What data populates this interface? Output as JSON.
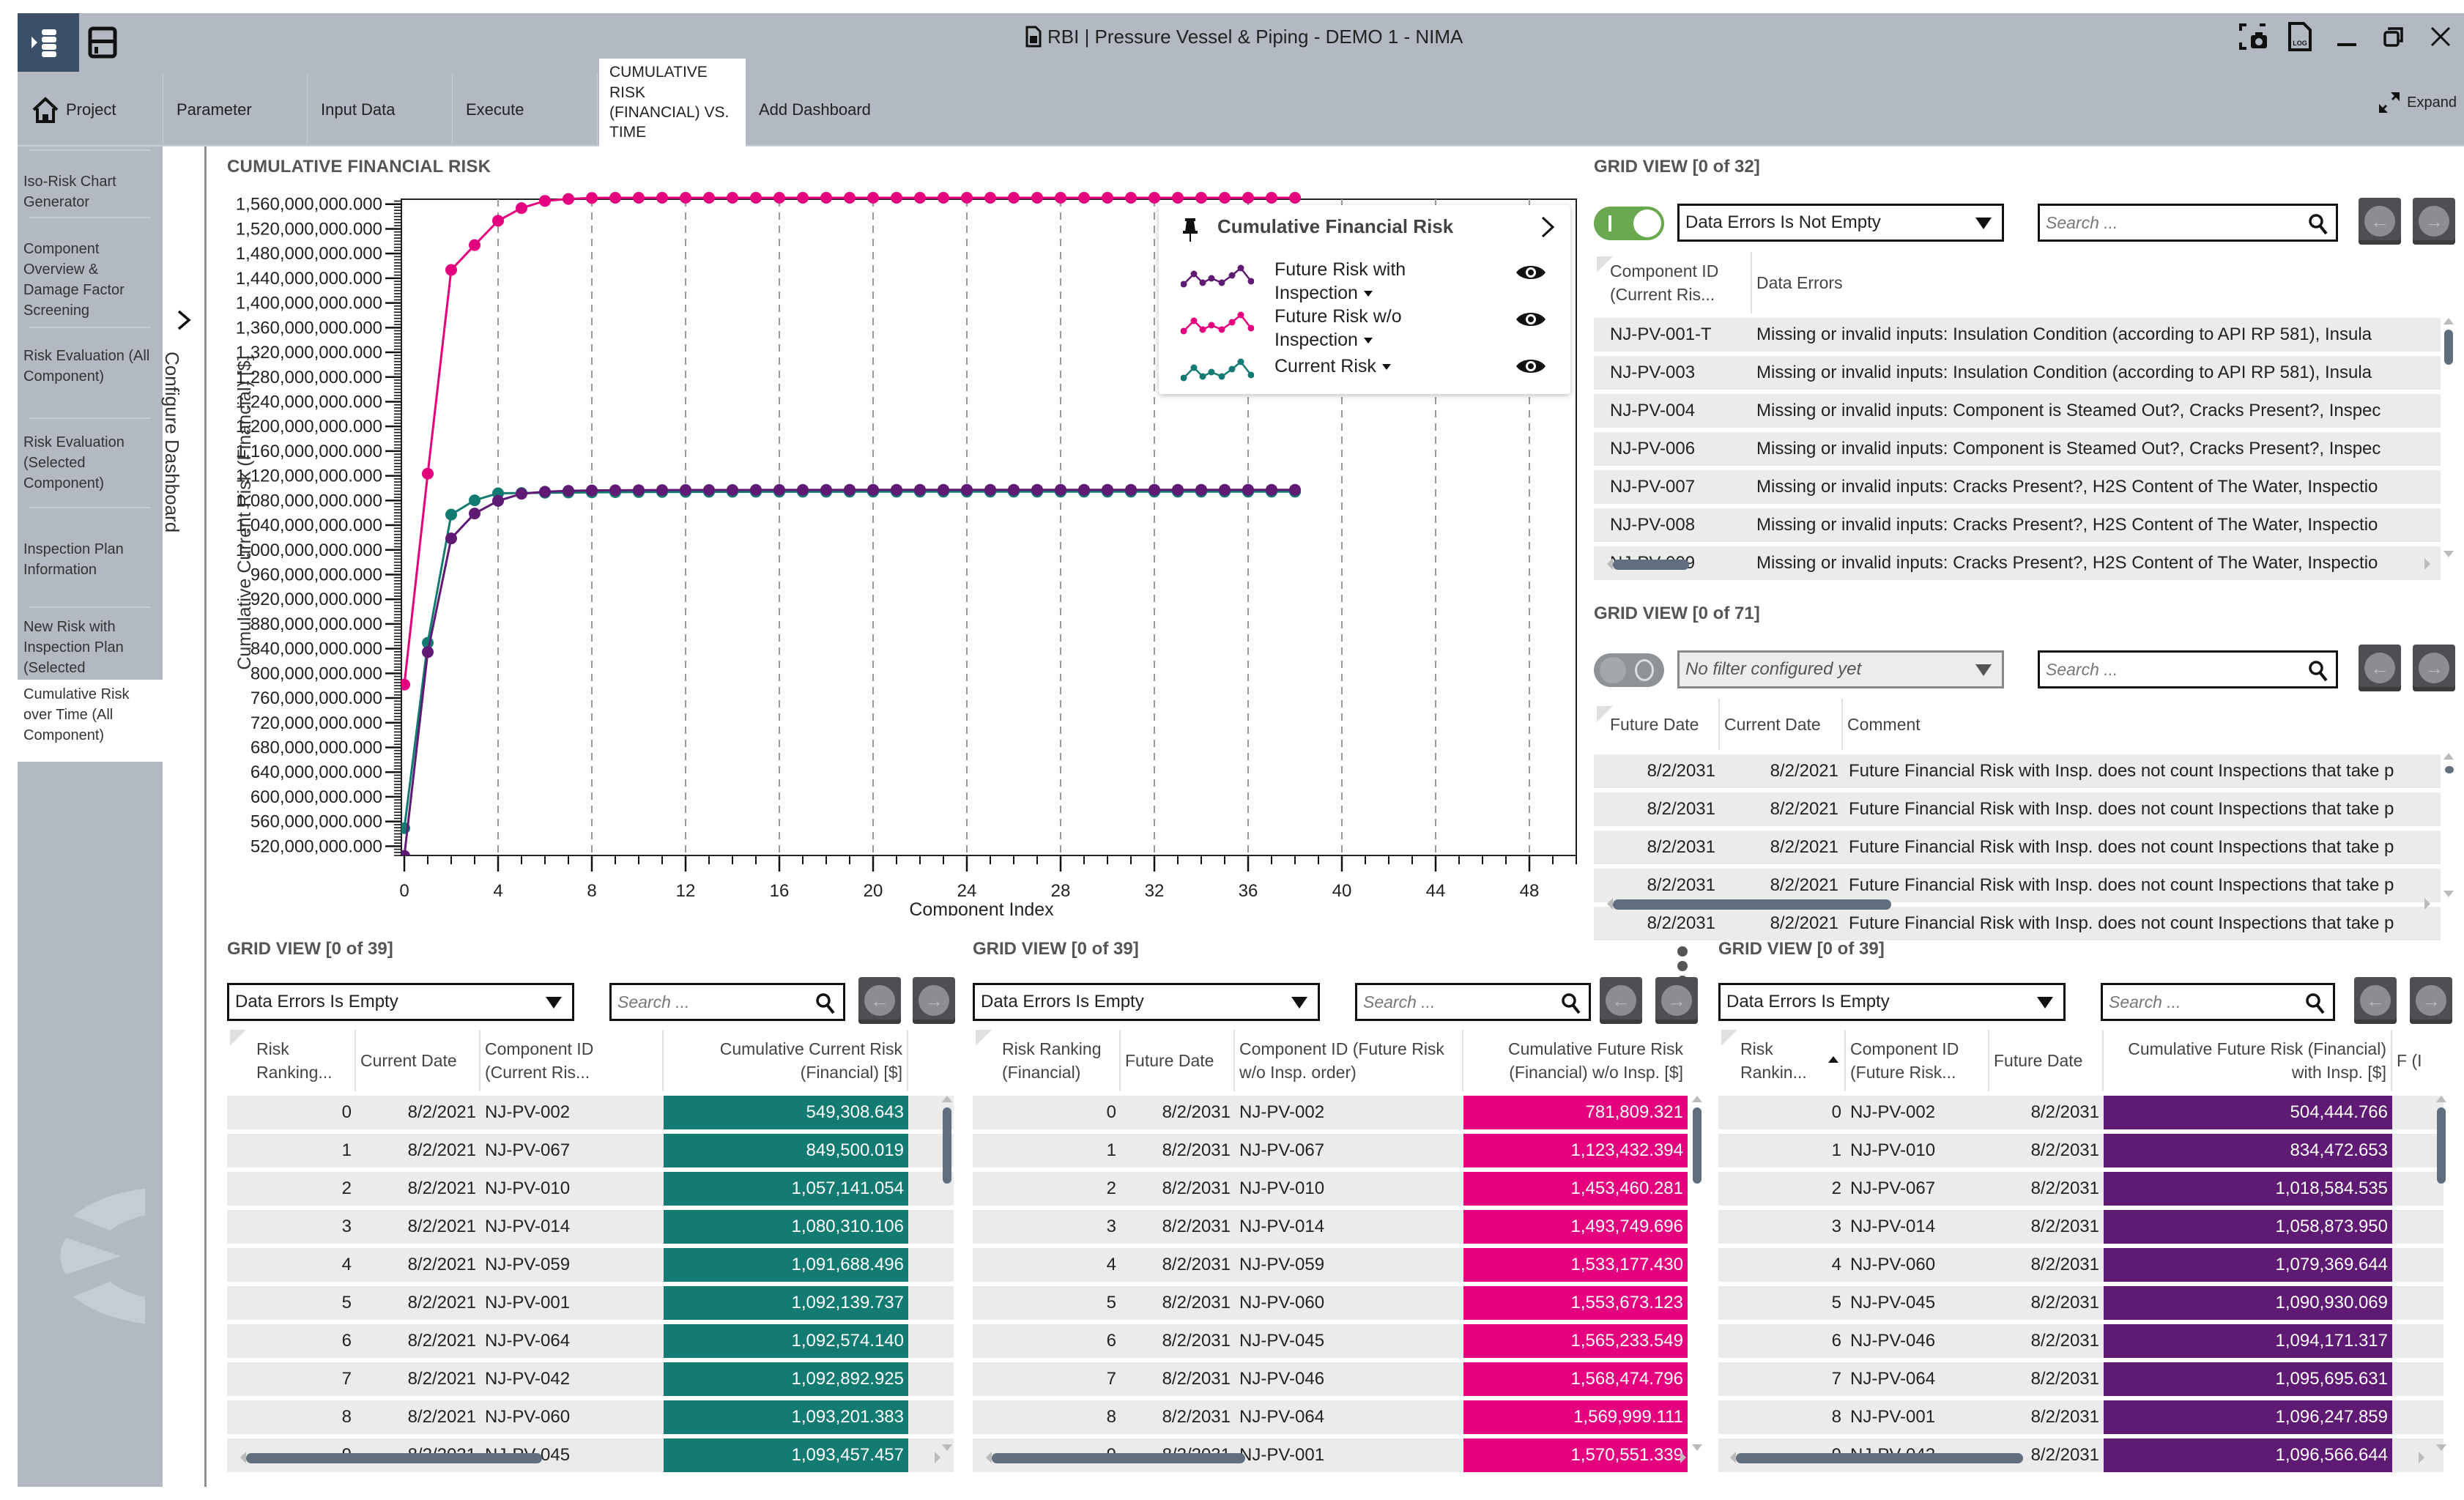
{
  "window": {
    "title": "RBI | Pressure Vessel & Piping - DEMO 1 - NIMA",
    "controls": [
      "screenshot-icon",
      "log-icon",
      "minimize-icon",
      "restore-icon",
      "close-icon"
    ]
  },
  "ribbon": {
    "tabs": [
      {
        "label": "Project",
        "icon": "home-icon"
      },
      {
        "label": "Parameter"
      },
      {
        "label": "Input Data"
      },
      {
        "label": "Execute"
      },
      {
        "label": "CUMULATIVE RISK (FINANCIAL) VS. TIME",
        "lines": [
          "CUMULATIVE",
          "RISK",
          "(FINANCIAL) VS.",
          "TIME"
        ],
        "active": true
      },
      {
        "label": "Add Dashboard"
      }
    ],
    "expand_label": "Expand"
  },
  "sidebar": {
    "items": [
      {
        "label": "Iso-Risk Chart Generator"
      },
      {
        "label": "Component Overview & Damage Factor Screening"
      },
      {
        "label": "Risk Evaluation (All Component)"
      },
      {
        "label": "Risk Evaluation (Selected Component)"
      },
      {
        "label": "Inspection Plan Information"
      },
      {
        "label": "New Risk with Inspection Plan (Selected Component)"
      },
      {
        "label": "Cumulative Risk over Time (All Component)",
        "active": true
      }
    ],
    "configure_label": "Configure Dashboard"
  },
  "chart_panel": {
    "title": "CUMULATIVE FINANCIAL RISK",
    "legend": {
      "title": "Cumulative Financial Risk",
      "items": [
        {
          "label": "Future Risk with Inspection",
          "color": "#5f1a73",
          "visible": true
        },
        {
          "label": "Future Risk w/o Inspection",
          "color": "#e5007e",
          "visible": true
        },
        {
          "label": "Current Risk",
          "color": "#137b72",
          "visible": true
        }
      ]
    }
  },
  "chart_data": {
    "type": "line",
    "title": "Cumulative Financial Risk",
    "xlabel": "Component Index",
    "ylabel": "Cumulative Current Risk (Financial) [$]",
    "xlim": [
      0,
      50
    ],
    "ylim": [
      505000000,
      1568000000
    ],
    "xticks": [
      0,
      4,
      8,
      12,
      16,
      20,
      24,
      28,
      32,
      36,
      40,
      44,
      48
    ],
    "yticks": [
      520000000,
      560000000,
      600000000,
      640000000,
      680000000,
      720000000,
      760000000,
      800000000,
      840000000,
      880000000,
      920000000,
      960000000,
      1000000000,
      1040000000,
      1080000000,
      1120000000,
      1160000000,
      1200000000,
      1240000000,
      1280000000,
      1320000000,
      1360000000,
      1400000000,
      1440000000,
      1480000000,
      1520000000,
      1560000000
    ],
    "ytick_labels": [
      "520,000,000.000",
      "560,000,000.000",
      "600,000,000.000",
      "640,000,000.000",
      "680,000,000.000",
      "720,000,000.000",
      "760,000,000.000",
      "800,000,000.000",
      "840,000,000.000",
      "880,000,000.000",
      "920,000,000.000",
      "960,000,000.000",
      "1,000,000,000.000",
      "1,040,000,000.000",
      "1,080,000,000.000",
      "1,120,000,000.000",
      "1,160,000,000.000",
      "1,200,000,000.000",
      "1,240,000,000.000",
      "1,280,000,000.000",
      "1,320,000,000.000",
      "1,360,000,000.000",
      "1,400,000,000.000",
      "1,440,000,000.000",
      "1,480,000,000.000",
      "1,520,000,000.000",
      "1,560,000,000.000"
    ],
    "grid": "vertical-dashed",
    "legend_position": "top-right",
    "x": [
      0,
      1,
      2,
      3,
      4,
      5,
      6,
      7,
      8,
      9,
      10,
      11,
      12,
      13,
      14,
      15,
      16,
      17,
      18,
      19,
      20,
      21,
      22,
      23,
      24,
      25,
      26,
      27,
      28,
      29,
      30,
      31,
      32,
      33,
      34,
      35,
      36,
      37,
      38
    ],
    "series": [
      {
        "name": "Future Risk w/o Inspection",
        "color": "#e5007e",
        "values": [
          781809321,
          1123432394,
          1453460281,
          1493749696,
          1533177430,
          1553673123,
          1565233549,
          1568474796,
          1569999111,
          1570551339,
          1570900000,
          1571000000,
          1571100000,
          1571150000,
          1571200000,
          1571200000,
          1571250000,
          1571250000,
          1571300000,
          1571300000,
          1571300000,
          1571300000,
          1571300000,
          1571300000,
          1571300000,
          1571300000,
          1571300000,
          1571300000,
          1571300000,
          1571300000,
          1571300000,
          1571300000,
          1571300000,
          1571300000,
          1571300000,
          1571300000,
          1571300000,
          1571300000,
          1571300000
        ]
      },
      {
        "name": "Current Risk",
        "color": "#137b72",
        "values": [
          549308643,
          849500019,
          1057141054,
          1080310106,
          1091688496,
          1092139737,
          1092574140,
          1092892925,
          1093201383,
          1093457457,
          1093650000,
          1093800000,
          1093900000,
          1094000000,
          1094050000,
          1094100000,
          1094150000,
          1094200000,
          1094200000,
          1094250000,
          1094250000,
          1094300000,
          1094300000,
          1094300000,
          1094300000,
          1094300000,
          1094300000,
          1094300000,
          1094300000,
          1094300000,
          1094300000,
          1094300000,
          1094300000,
          1094300000,
          1094300000,
          1094300000,
          1094300000,
          1094300000,
          1094300000
        ]
      },
      {
        "name": "Future Risk with Inspection",
        "color": "#5f1a73",
        "values": [
          504444766,
          834472653,
          1018584535,
          1058873950,
          1079369644,
          1090930069,
          1094171317,
          1095695631,
          1096247859,
          1096566644,
          1096750000,
          1096850000,
          1096950000,
          1097000000,
          1097050000,
          1097100000,
          1097100000,
          1097150000,
          1097150000,
          1097200000,
          1097200000,
          1097200000,
          1097200000,
          1097200000,
          1097200000,
          1097200000,
          1097200000,
          1097200000,
          1097200000,
          1097200000,
          1097200000,
          1097200000,
          1097200000,
          1097200000,
          1097200000,
          1097200000,
          1097200000,
          1097200000,
          1097200000
        ]
      }
    ]
  },
  "grid_errors": {
    "title": "GRID VIEW [0 of 32]",
    "toggle_on": true,
    "filter": "Data Errors Is Not Empty",
    "search_placeholder": "Search ...",
    "columns": [
      "Component ID (Current Ris...",
      "Data Errors"
    ],
    "rows": [
      [
        "NJ-PV-001-T",
        "Missing or invalid inputs: Insulation Condition (according to API RP 581), Insula"
      ],
      [
        "NJ-PV-003",
        "Missing or invalid inputs: Insulation Condition (according to API RP 581), Insula"
      ],
      [
        "NJ-PV-004",
        "Missing or invalid inputs: Component is Steamed Out?, Cracks Present?, Inspec"
      ],
      [
        "NJ-PV-006",
        "Missing or invalid inputs: Component is Steamed Out?, Cracks Present?, Inspec"
      ],
      [
        "NJ-PV-007",
        "Missing or invalid inputs: Cracks Present?, H2S Content of The Water, Inspectio"
      ],
      [
        "NJ-PV-008",
        "Missing or invalid inputs: Cracks Present?, H2S Content of The Water, Inspectio"
      ],
      [
        "NJ-PV-009",
        "Missing or invalid inputs: Cracks Present?, H2S Content of The Water, Inspectio"
      ]
    ]
  },
  "grid_comments": {
    "title": "GRID VIEW [0 of 71]",
    "toggle_on": false,
    "filter": "No filter configured yet",
    "search_placeholder": "Search ...",
    "columns": [
      "Future Date",
      "Current Date",
      "Comment"
    ],
    "rows": [
      [
        "8/2/2031",
        "8/2/2021",
        "Future Financial Risk with Insp. does not count Inspections that take p"
      ],
      [
        "8/2/2031",
        "8/2/2021",
        "Future Financial Risk with Insp. does not count Inspections that take p"
      ],
      [
        "8/2/2031",
        "8/2/2021",
        "Future Financial Risk with Insp. does not count Inspections that take p"
      ],
      [
        "8/2/2031",
        "8/2/2021",
        "Future Financial Risk with Insp. does not count Inspections that take p"
      ],
      [
        "8/2/2031",
        "8/2/2021",
        "Future Financial Risk with Insp. does not count Inspections that take p"
      ]
    ]
  },
  "grid_current": {
    "title": "GRID VIEW [0 of 39]",
    "filter": "Data Errors Is Empty",
    "search_placeholder": "Search ...",
    "columns": [
      "Risk Ranking...",
      "Current Date",
      "Component ID (Current Ris...",
      "Cumulative Current Risk (Financial) [$]"
    ],
    "rows": [
      [
        "0",
        "8/2/2021",
        "NJ-PV-002",
        "549,308.643"
      ],
      [
        "1",
        "8/2/2021",
        "NJ-PV-067",
        "849,500.019"
      ],
      [
        "2",
        "8/2/2021",
        "NJ-PV-010",
        "1,057,141.054"
      ],
      [
        "3",
        "8/2/2021",
        "NJ-PV-014",
        "1,080,310.106"
      ],
      [
        "4",
        "8/2/2021",
        "NJ-PV-059",
        "1,091,688.496"
      ],
      [
        "5",
        "8/2/2021",
        "NJ-PV-001",
        "1,092,139.737"
      ],
      [
        "6",
        "8/2/2021",
        "NJ-PV-064",
        "1,092,574.140"
      ],
      [
        "7",
        "8/2/2021",
        "NJ-PV-042",
        "1,092,892.925"
      ],
      [
        "8",
        "8/2/2021",
        "NJ-PV-060",
        "1,093,201.383"
      ],
      [
        "9",
        "8/2/2021",
        "NJ-PV-045",
        "1,093,457.457"
      ]
    ]
  },
  "grid_future_wo": {
    "title": "GRID VIEW [0 of 39]",
    "filter": "Data Errors Is Empty",
    "search_placeholder": "Search ...",
    "columns": [
      "Risk Ranking (Financial)",
      "Future Date",
      "Component ID (Future Risk w/o Insp. order)",
      "Cumulative Future Risk (Financial) w/o Insp. [$]"
    ],
    "rows": [
      [
        "0",
        "8/2/2031",
        "NJ-PV-002",
        "781,809.321"
      ],
      [
        "1",
        "8/2/2031",
        "NJ-PV-067",
        "1,123,432.394"
      ],
      [
        "2",
        "8/2/2031",
        "NJ-PV-010",
        "1,453,460.281"
      ],
      [
        "3",
        "8/2/2031",
        "NJ-PV-014",
        "1,493,749.696"
      ],
      [
        "4",
        "8/2/2031",
        "NJ-PV-059",
        "1,533,177.430"
      ],
      [
        "5",
        "8/2/2031",
        "NJ-PV-060",
        "1,553,673.123"
      ],
      [
        "6",
        "8/2/2031",
        "NJ-PV-045",
        "1,565,233.549"
      ],
      [
        "7",
        "8/2/2031",
        "NJ-PV-046",
        "1,568,474.796"
      ],
      [
        "8",
        "8/2/2031",
        "NJ-PV-064",
        "1,569,999.111"
      ],
      [
        "9",
        "8/2/2031",
        "NJ-PV-001",
        "1,570,551.339"
      ]
    ]
  },
  "grid_future_with": {
    "title": "GRID VIEW [0 of 39]",
    "filter": "Data Errors Is Empty",
    "search_placeholder": "Search ...",
    "columns": [
      "Risk Rankin...",
      "Component ID (Future Risk...",
      "Future Date",
      "Cumulative Future Risk (Financial) with Insp. [$]",
      "F (I"
    ],
    "sort_indicator": "ascending",
    "rows": [
      [
        "0",
        "NJ-PV-002",
        "8/2/2031",
        "504,444.766"
      ],
      [
        "1",
        "NJ-PV-010",
        "8/2/2031",
        "834,472.653"
      ],
      [
        "2",
        "NJ-PV-067",
        "8/2/2031",
        "1,018,584.535"
      ],
      [
        "3",
        "NJ-PV-014",
        "8/2/2031",
        "1,058,873.950"
      ],
      [
        "4",
        "NJ-PV-060",
        "8/2/2031",
        "1,079,369.644"
      ],
      [
        "5",
        "NJ-PV-045",
        "8/2/2031",
        "1,090,930.069"
      ],
      [
        "6",
        "NJ-PV-046",
        "8/2/2031",
        "1,094,171.317"
      ],
      [
        "7",
        "NJ-PV-064",
        "8/2/2031",
        "1,095,695.631"
      ],
      [
        "8",
        "NJ-PV-001",
        "8/2/2031",
        "1,096,247.859"
      ],
      [
        "9",
        "NJ-PV-042",
        "8/2/2031",
        "1,096,566.644"
      ]
    ]
  }
}
